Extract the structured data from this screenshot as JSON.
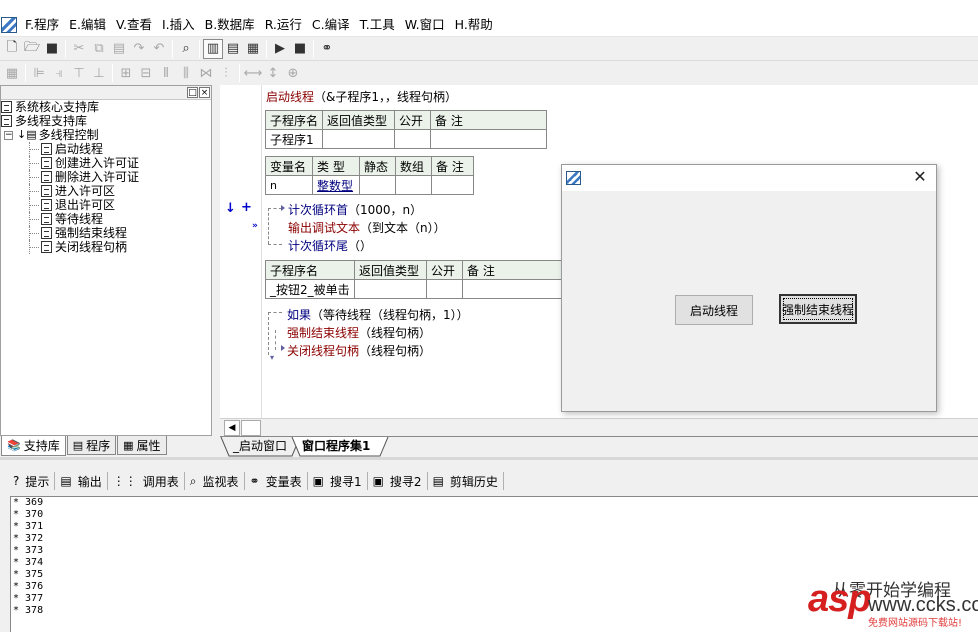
{
  "menu": {
    "items": [
      "F.程序",
      "E.编辑",
      "V.查看",
      "I.插入",
      "B.数据库",
      "R.运行",
      "C.编译",
      "T.工具",
      "W.窗口",
      "H.帮助"
    ]
  },
  "toolbar": {
    "icons": [
      "new-file-icon",
      "open-folder-icon",
      "save-icon",
      "cut-icon",
      "copy-icon",
      "paste-icon",
      "redo-icon",
      "undo-icon",
      "find-icon",
      "layout-1-icon",
      "layout-2-icon",
      "layout-3-icon",
      "run-icon",
      "stop-icon",
      "binoculars-icon"
    ]
  },
  "tree": {
    "libraries": [
      {
        "label": "系统核心支持库"
      },
      {
        "label": "多线程支持库"
      }
    ],
    "folder": "多线程控制",
    "commands": [
      "启动线程",
      "创建进入许可证",
      "删除进入许可证",
      "进入许可区",
      "退出许可区",
      "等待线程",
      "强制结束线程",
      "关闭线程句柄"
    ]
  },
  "left_tabs": [
    "支持库",
    "程序",
    "属性"
  ],
  "code": {
    "line1_fn": "启动线程",
    "line1_args": "（&子程序1，，线程句柄）",
    "sub1_headers": [
      "子程序名",
      "返回值类型",
      "公开",
      "备 注"
    ],
    "sub1_name": "子程序1",
    "var_headers": [
      "变量名",
      "类 型",
      "静态",
      "数组",
      "备 注"
    ],
    "var_name": "n",
    "var_type": "整数型",
    "loop_start": "计次循环首",
    "loop_start_args": "（1000，n）",
    "loop_body_fn": "输出调试文本",
    "loop_body_args": "（到文本（n））",
    "loop_end": "计次循环尾",
    "loop_end_args": "（）",
    "sub2_headers": [
      "子程序名",
      "返回值类型",
      "公开",
      "备 注"
    ],
    "sub2_name": "_按钮2_被单击",
    "if_kw": "如果",
    "if_args": "（等待线程（线程句柄，1））",
    "kill_fn": "强制结束线程",
    "kill_args": "（线程句柄）",
    "close_fn": "关闭线程句柄",
    "close_args": "（线程句柄）"
  },
  "editor_tabs": [
    "_启动窗口",
    "窗口程序集1"
  ],
  "output_tabs": [
    {
      "label": "提示",
      "icon": "question-icon"
    },
    {
      "label": "输出",
      "icon": "output-icon"
    },
    {
      "label": "调用表",
      "icon": "call-table-icon"
    },
    {
      "label": "监视表",
      "icon": "magnifier-icon"
    },
    {
      "label": "变量表",
      "icon": "variables-icon"
    },
    {
      "label": "搜寻1",
      "icon": "search1-icon"
    },
    {
      "label": "搜寻2",
      "icon": "search2-icon"
    },
    {
      "label": "剪辑历史",
      "icon": "clip-history-icon"
    }
  ],
  "output_lines": [
    "* 369",
    "* 370",
    "* 371",
    "* 372",
    "* 373",
    "* 374",
    "* 375",
    "* 376",
    "* 377",
    "* 378"
  ],
  "dialog": {
    "start_button": "启动线程",
    "kill_button": "强制结束线程"
  },
  "watermark": {
    "line1": "从零开始学编程",
    "brand": "asp",
    "url": "www.ccks.com",
    "sub": "免费网站源码下载站!"
  }
}
